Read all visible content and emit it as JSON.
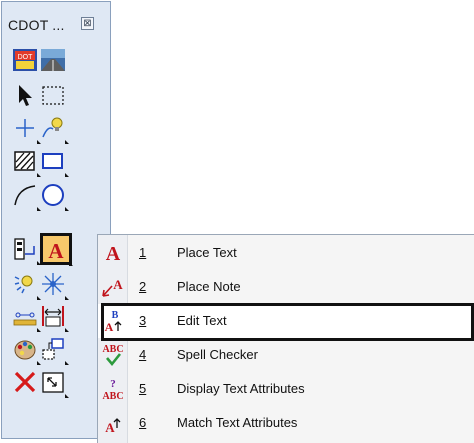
{
  "palette": {
    "title": "CDOT ...",
    "close_glyph": "⊠",
    "tools": [
      {
        "icon": "cdot-logo-icon"
      },
      {
        "icon": "highway-image-icon"
      },
      {
        "icon": "arrow-pointer-icon"
      },
      {
        "icon": "dashed-selection-icon"
      },
      {
        "icon": "crosshair-icon"
      },
      {
        "icon": "tentative-bulb-icon"
      },
      {
        "icon": "hatch-pattern-icon"
      },
      {
        "icon": "rectangle-icon"
      },
      {
        "icon": "arc-icon"
      },
      {
        "icon": "circle-icon"
      },
      {
        "icon": "cell-placement-icon"
      },
      {
        "icon": "place-text-icon",
        "selected": true
      },
      {
        "icon": "sparkle-bulb-icon"
      },
      {
        "icon": "pattern-burst-icon"
      },
      {
        "icon": "dimension-icon"
      },
      {
        "icon": "measure-icon"
      },
      {
        "icon": "palette-icon"
      },
      {
        "icon": "reference-icon"
      },
      {
        "icon": "delete-x-icon"
      },
      {
        "icon": "zoom-fit-icon"
      }
    ]
  },
  "menu": {
    "items": [
      {
        "number": "1",
        "label": "Place Text",
        "icon": "place-text-icon"
      },
      {
        "number": "2",
        "label": "Place Note",
        "icon": "place-note-icon"
      },
      {
        "number": "3",
        "label": "Edit Text",
        "icon": "edit-text-icon",
        "highlighted": true
      },
      {
        "number": "4",
        "label": "Spell Checker",
        "icon": "spell-checker-icon"
      },
      {
        "number": "5",
        "label": "Display Text Attributes",
        "icon": "display-text-attributes-icon"
      },
      {
        "number": "6",
        "label": "Match Text Attributes",
        "icon": "match-text-attributes-icon"
      }
    ]
  },
  "colors": {
    "palette_bg": "#dfe8f4",
    "text_red": "#c0141c",
    "text_blue": "#1d3fbf",
    "highlight_border": "#111111"
  }
}
